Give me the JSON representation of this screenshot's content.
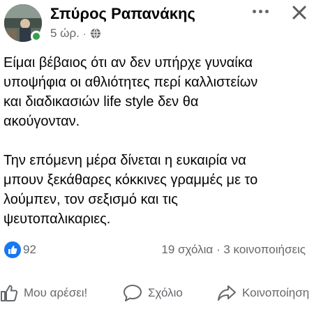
{
  "post": {
    "author": "Σπύρος Ραπανάκης",
    "time": "5 ώρ.",
    "separator": "·",
    "paragraphs": [
      "Είμαι βέβαιος ότι αν δεν υπήρχε γυναίκα\nυποψήφια οι αθλιότητες περί καλλιστείων\nκαι διαδικασιών life style δεν θα\nακούγονταν.",
      "Την επόμενη μέρα δίνεται η ευκαιρία να\nμπουν ξεκάθαρες κόκκινες γραμμές με το\nλούμπεν, τον σεξισμό και τις\nψευτοπαλικαριες."
    ]
  },
  "stats": {
    "reactions": "92",
    "comments_shares": "19 σχόλια · 3 κοινοποιήσεις"
  },
  "actions": {
    "like": "Μου αρέσει!",
    "comment": "Σχόλιο",
    "share": "Κοινοποίηση"
  },
  "icons": {
    "more": "more-options-icon",
    "close": "close-icon",
    "privacy": "globe-icon",
    "like": "thumbs-up-icon",
    "comment": "comment-bubble-icon",
    "share": "share-arrow-icon"
  },
  "colors": {
    "like_blue": "#1877f2",
    "online_green": "#31a24c",
    "secondary_text": "#65676b"
  }
}
